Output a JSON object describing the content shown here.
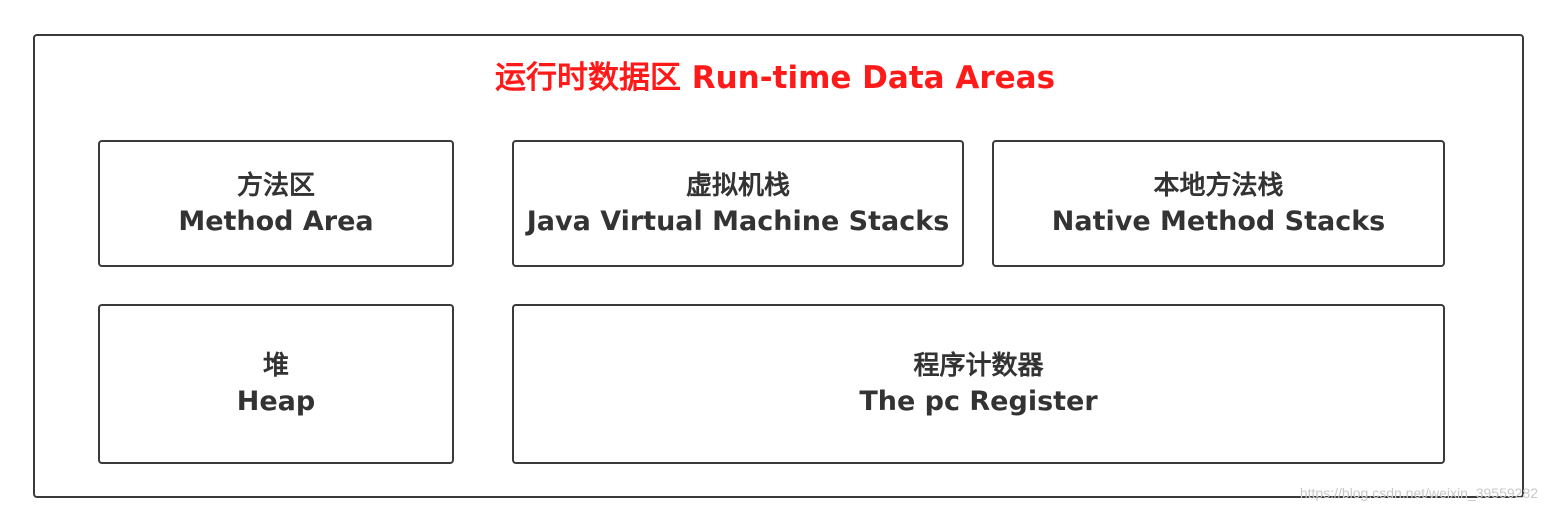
{
  "title": "运行时数据区 Run-time Data Areas",
  "areas": [
    {
      "zh": "方法区",
      "en": "Method Area"
    },
    {
      "zh": "虚拟机栈",
      "en": "Java Virtual Machine Stacks"
    },
    {
      "zh": "本地方法栈",
      "en": "Native Method Stacks"
    },
    {
      "zh": "堆",
      "en": "Heap"
    },
    {
      "zh": "程序计数器",
      "en": "The pc Register"
    }
  ],
  "watermark": "https://blog.csdn.net/weixin_39559282",
  "colors": {
    "title": "#ff1a1a",
    "border": "#3a3a3a",
    "text": "#333333"
  }
}
